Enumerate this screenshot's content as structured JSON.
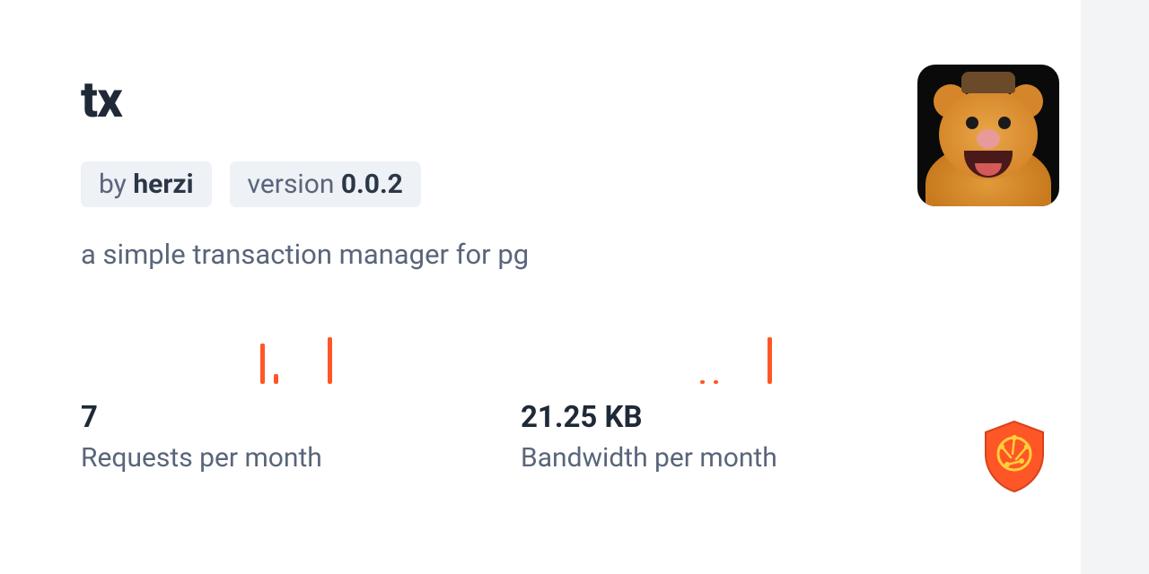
{
  "package": {
    "name": "tx",
    "author_prefix": "by ",
    "author": "herzi",
    "version_prefix": "version ",
    "version": "0.0.2",
    "description": "a simple transaction manager for pg"
  },
  "stats": {
    "requests": {
      "value": "7",
      "label": "Requests per month"
    },
    "bandwidth": {
      "value": "21.25 KB",
      "label": "Bandwidth per month"
    }
  },
  "chart_data": [
    {
      "type": "bar",
      "title": "Requests per month sparkline",
      "values": [
        0,
        0,
        0,
        0,
        0,
        0,
        0,
        0,
        40,
        10,
        0,
        0,
        0,
        46,
        0,
        0,
        0,
        0
      ],
      "ylim": [
        0,
        50
      ]
    },
    {
      "type": "bar",
      "title": "Bandwidth per month sparkline",
      "values": [
        0,
        0,
        0,
        0,
        0,
        0,
        0,
        0,
        4,
        4,
        0,
        0,
        0,
        46,
        0,
        0,
        0,
        0
      ],
      "ylim": [
        0,
        50
      ]
    }
  ],
  "colors": {
    "accent": "#ff5627",
    "text_dark": "#1f2937",
    "text_muted": "#59657a",
    "badge_bg": "#eef1f5"
  }
}
